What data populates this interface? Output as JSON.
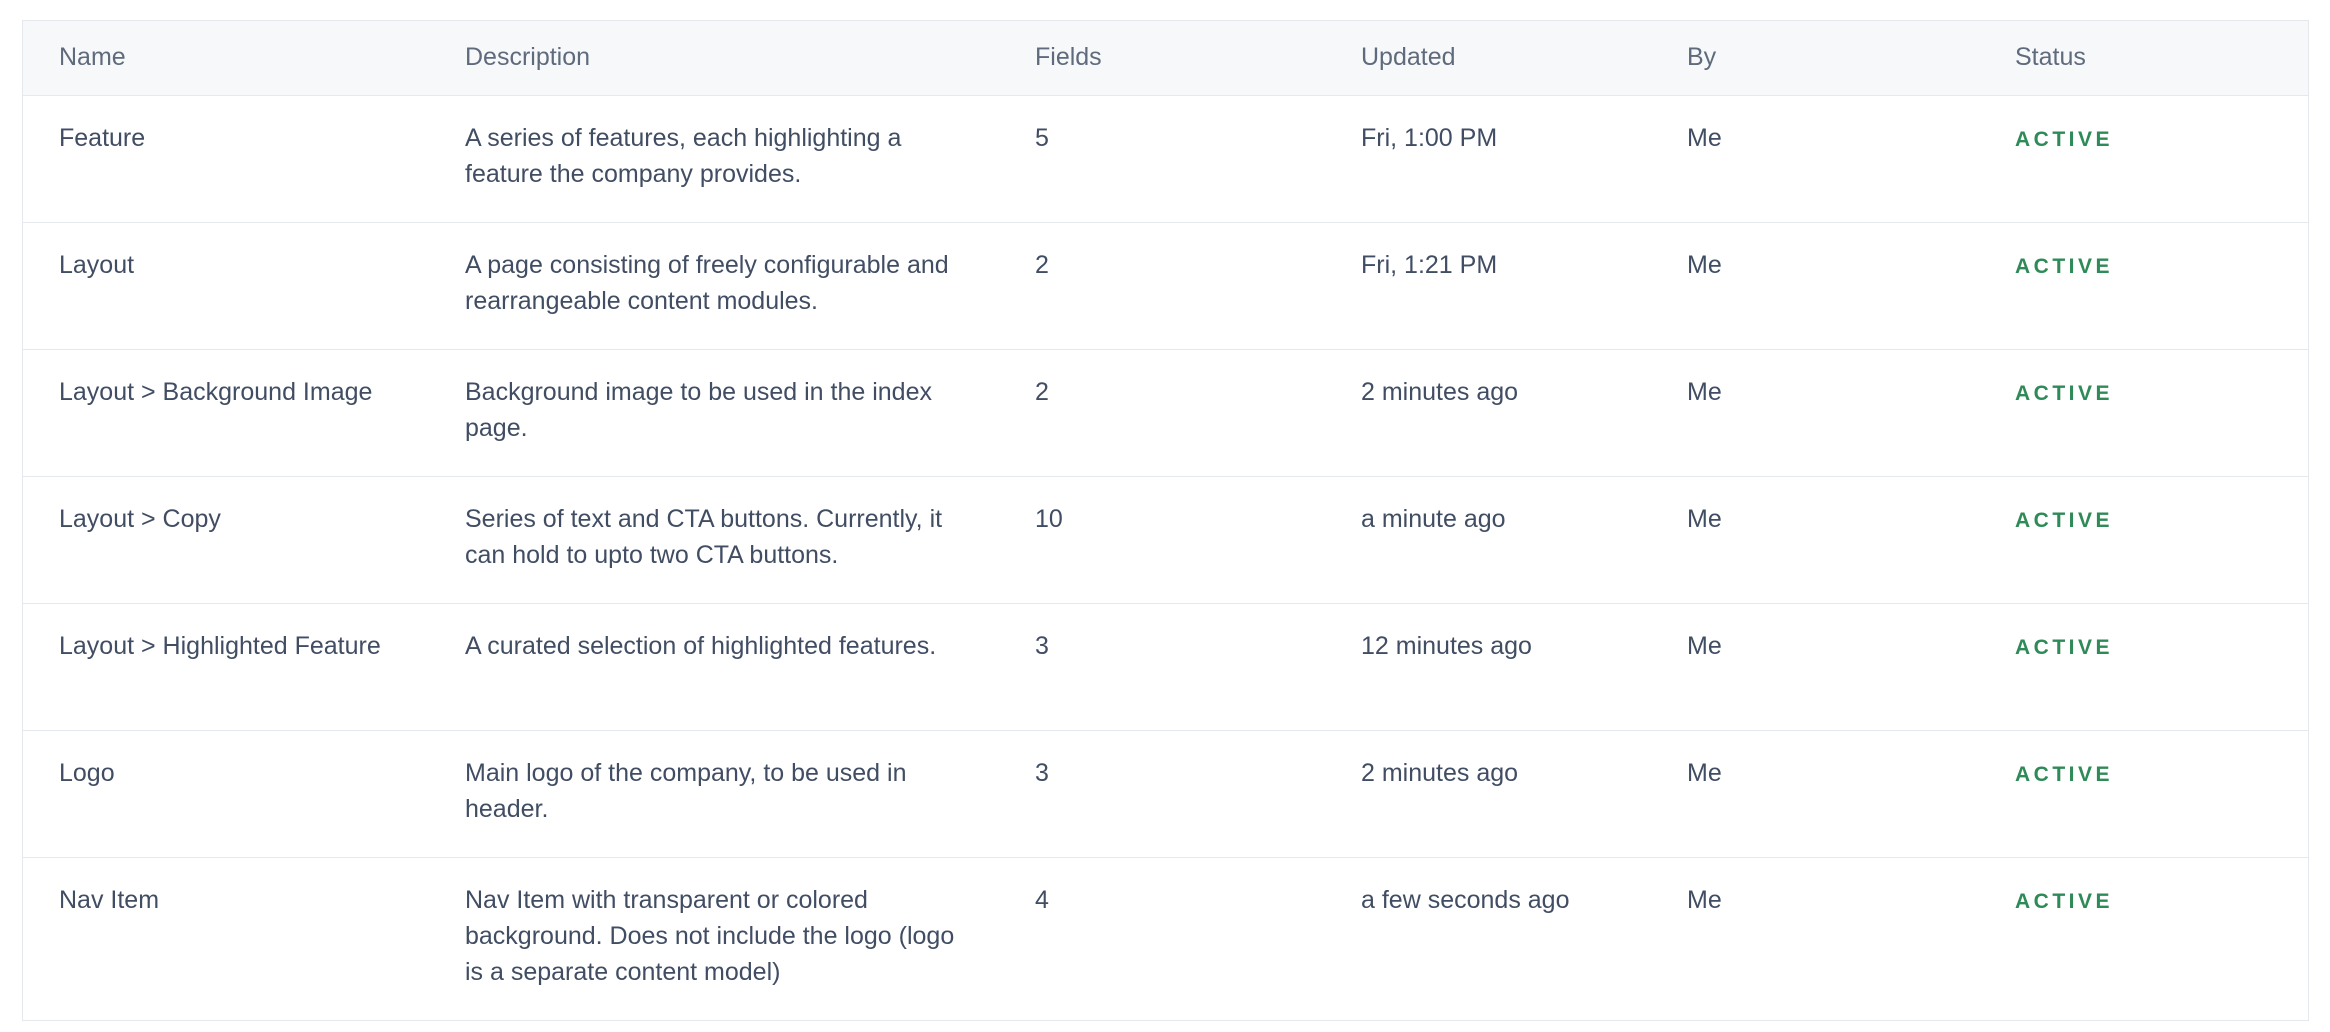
{
  "table": {
    "headers": [
      "Name",
      "Description",
      "Fields",
      "Updated",
      "By",
      "Status"
    ],
    "rows": [
      {
        "name": "Feature",
        "description": "A series of features, each highlighting a feature the company provides.",
        "fields": "5",
        "updated": "Fri, 1:00 PM",
        "by": "Me",
        "status": "ACTIVE"
      },
      {
        "name": "Layout",
        "description": "A page consisting of freely configurable and rearrangeable content modules.",
        "fields": "2",
        "updated": "Fri, 1:21 PM",
        "by": "Me",
        "status": "ACTIVE"
      },
      {
        "name": "Layout > Background Image",
        "description": "Background image to be used in the index page.",
        "fields": "2",
        "updated": "2 minutes ago",
        "by": "Me",
        "status": "ACTIVE"
      },
      {
        "name": "Layout > Copy",
        "description": "Series of text and CTA buttons. Currently, it can hold to upto two CTA buttons.",
        "fields": "10",
        "updated": "a minute ago",
        "by": "Me",
        "status": "ACTIVE"
      },
      {
        "name": "Layout > Highlighted Feature",
        "description": "A curated selection of highlighted features.",
        "fields": "3",
        "updated": "12 minutes ago",
        "by": "Me",
        "status": "ACTIVE"
      },
      {
        "name": "Logo",
        "description": "Main logo of the company, to be used in header.",
        "fields": "3",
        "updated": "2 minutes ago",
        "by": "Me",
        "status": "ACTIVE"
      },
      {
        "name": "Nav Item",
        "description": "Nav Item with transparent or colored background. Does not include the logo (logo is a separate content model)",
        "fields": "4",
        "updated": "a few seconds ago",
        "by": "Me",
        "status": "ACTIVE"
      }
    ]
  },
  "colors": {
    "status_active": "#2e8a57",
    "header_bg": "#f7f8fa",
    "border": "#e5e8ec",
    "text": "#414d63"
  }
}
